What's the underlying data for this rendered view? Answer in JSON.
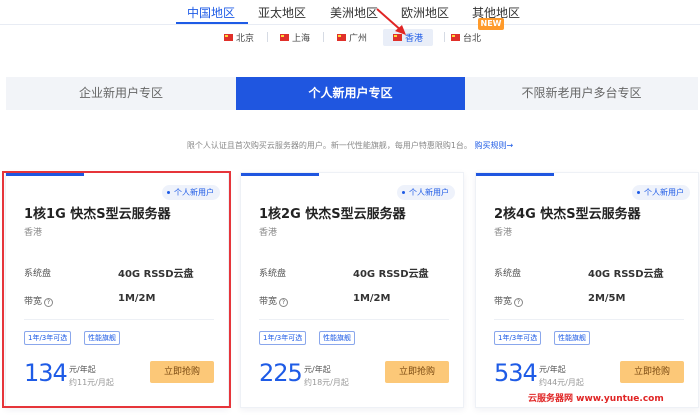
{
  "regions": {
    "tabs": [
      "中国地区",
      "亚太地区",
      "美洲地区",
      "欧洲地区",
      "其他地区"
    ],
    "active": "中国地区",
    "new_badge": "NEW"
  },
  "cities": {
    "items": [
      "北京",
      "上海",
      "广州",
      "香港",
      "台北"
    ],
    "active": "香港"
  },
  "user_types": {
    "tabs": [
      "企业新用户专区",
      "个人新用户专区",
      "不限新老用户多台专区"
    ],
    "active": "个人新用户专区"
  },
  "notice": {
    "text": "限个人认证且首次购买云服务器的用户。新一代性能旗舰，每用户特惠限购1台。",
    "link": "购买规则→"
  },
  "products": [
    {
      "badge": "个人新用户",
      "title": "1核1G 快杰S型云服务器",
      "location": "香港",
      "disk_label": "系统盘",
      "disk": "40G RSSD云盘",
      "bandwidth_label": "带宽",
      "bandwidth": "1M/2M",
      "tags": [
        "1年/3年可选",
        "性能旗舰"
      ],
      "price": "134",
      "price_unit": "元/年起",
      "monthly": "约11元/月起",
      "buy_label": "立即抢购"
    },
    {
      "badge": "个人新用户",
      "title": "1核2G 快杰S型云服务器",
      "location": "香港",
      "disk_label": "系统盘",
      "disk": "40G RSSD云盘",
      "bandwidth_label": "带宽",
      "bandwidth": "1M/2M",
      "tags": [
        "1年/3年可选",
        "性能旗舰"
      ],
      "price": "225",
      "price_unit": "元/年起",
      "monthly": "约18元/月起",
      "buy_label": "立即抢购"
    },
    {
      "badge": "个人新用户",
      "title": "2核4G 快杰S型云服务器",
      "location": "香港",
      "disk_label": "系统盘",
      "disk": "40G RSSD云盘",
      "bandwidth_label": "带宽",
      "bandwidth": "2M/5M",
      "tags": [
        "1年/3年可选",
        "性能旗舰"
      ],
      "price": "534",
      "price_unit": "元/年起",
      "monthly": "约44元/月起",
      "buy_label": "立即抢购"
    }
  ],
  "watermark": "云服务器网 www.yuntue.com",
  "colors": {
    "accent": "#1f56e0",
    "buy_button": "#fcc878",
    "new_badge": "#ff9a2a",
    "highlight": "#e6353a"
  }
}
